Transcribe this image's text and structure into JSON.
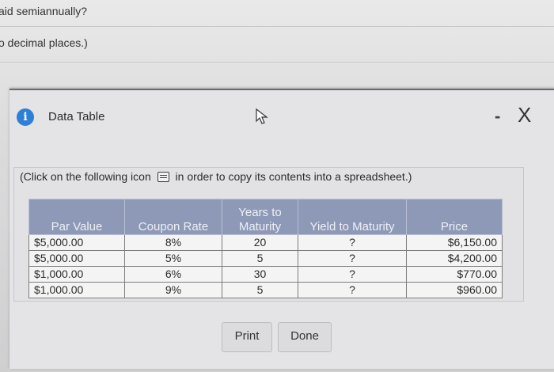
{
  "background": {
    "line1": "aid semiannually?",
    "line2": "o decimal places.)"
  },
  "dialog": {
    "title": "Data Table",
    "minimize_label": "-",
    "close_label": "X",
    "instruction_before": "(Click on the following icon",
    "instruction_after": "in order to copy its contents into a spreadsheet.)",
    "table": {
      "headers": [
        "Par Value",
        "Coupon Rate",
        "Years to Maturity",
        "Yield to Maturity",
        "Price"
      ],
      "rows": [
        [
          "$5,000.00",
          "8%",
          "20",
          "?",
          "$6,150.00"
        ],
        [
          "$5,000.00",
          "5%",
          "5",
          "?",
          "$4,200.00"
        ],
        [
          "$1,000.00",
          "6%",
          "30",
          "?",
          "$770.00"
        ],
        [
          "$1,000.00",
          "9%",
          "5",
          "?",
          "$960.00"
        ]
      ]
    },
    "buttons": {
      "print": "Print",
      "done": "Done"
    }
  },
  "colors": {
    "header_bg": "#8e99b7",
    "info_icon": "#2f7fd6"
  }
}
